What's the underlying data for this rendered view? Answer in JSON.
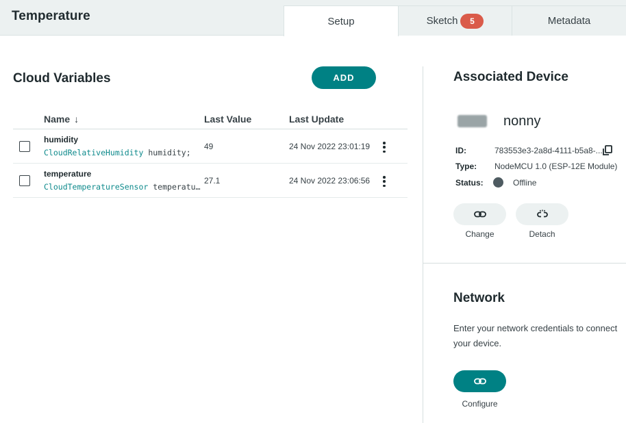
{
  "header": {
    "title": "Temperature",
    "tabs": [
      {
        "label": "Setup",
        "active": true
      },
      {
        "label": "Sketch",
        "badge": "5"
      },
      {
        "label": "Metadata"
      }
    ]
  },
  "cloud_variables": {
    "title": "Cloud Variables",
    "add_label": "ADD",
    "columns": {
      "name": "Name",
      "last_value": "Last Value",
      "last_update": "Last Update"
    },
    "rows": [
      {
        "name": "humidity",
        "type": "CloudRelativeHumidity",
        "decl_rest": " humidity;",
        "value": "49",
        "update": "24 Nov 2022 23:01:19"
      },
      {
        "name": "temperature",
        "type": "CloudTemperatureSensor",
        "decl_rest": " temperature;",
        "value": "27.1",
        "update": "24 Nov 2022 23:06:56"
      }
    ]
  },
  "associated_device": {
    "title": "Associated Device",
    "name": "nonny",
    "id_label": "ID:",
    "id_value": "783553e3-2a8d-4111-b5a8-...",
    "type_label": "Type:",
    "type_value": "NodeMCU 1.0 (ESP-12E Module)",
    "status_label": "Status:",
    "status_value": "Offline",
    "change_label": "Change",
    "detach_label": "Detach"
  },
  "network": {
    "title": "Network",
    "description": "Enter your network credentials to connect your device.",
    "configure_label": "Configure"
  },
  "colors": {
    "accent": "#008184",
    "badge": "#DA5B4A",
    "header_bg": "#ECF1F1",
    "status_offline": "#4e5b61"
  }
}
